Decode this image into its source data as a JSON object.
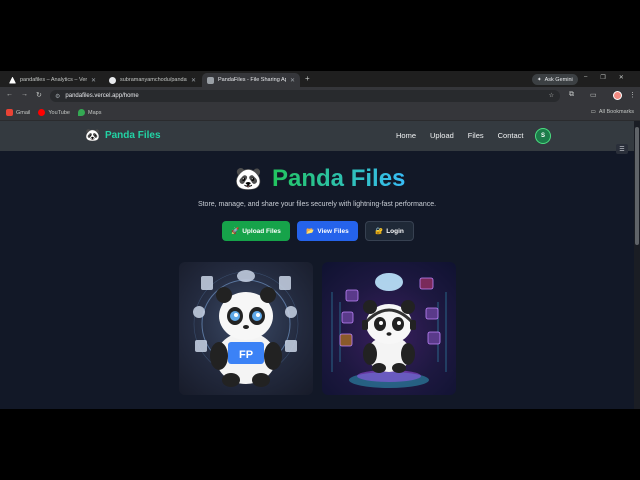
{
  "browser": {
    "tabs": [
      {
        "title": "pandafiles – Analytics – Vercel",
        "favicon_color": "#ffffff",
        "active": false
      },
      {
        "title": "subramanyamchodu/pandafiles",
        "favicon_color": "#e8eaed",
        "active": false
      },
      {
        "title": "PandaFiles - File Sharing App",
        "favicon_color": "#9aa0a6",
        "active": true
      }
    ],
    "new_tab": "+",
    "ask_gemini": "Ask Gemini",
    "url": "pandafiles.vercel.app/home",
    "bookmarks": [
      {
        "label": "Gmail",
        "color": "#ea4335"
      },
      {
        "label": "YouTube",
        "color": "#ff0000"
      },
      {
        "label": "Maps",
        "color": "#34a853"
      }
    ],
    "all_bookmarks": "All Bookmarks"
  },
  "site": {
    "brand": "Panda Files",
    "brand_icon": "🐼",
    "nav": [
      "Home",
      "Upload",
      "Files",
      "Contact"
    ],
    "avatar_initial": "S",
    "hero_icon": "🐼",
    "hero_title": "Panda Files",
    "subtitle": "Store, manage, and share your files securely with lightning-fast performance.",
    "buttons": {
      "upload": "Upload Files",
      "upload_icon": "🚀",
      "view": "View Files",
      "view_icon": "📂",
      "login": "Login",
      "login_icon": "🔐"
    },
    "images": [
      {
        "name": "panda-with-file-icons",
        "caption_text": "FP"
      },
      {
        "name": "panda-with-headphones-cloud"
      }
    ],
    "colors": {
      "accent_green": "#22c55e",
      "accent_blue": "#2563eb",
      "navbar": "#343a40",
      "page_bg": "#121827"
    }
  }
}
